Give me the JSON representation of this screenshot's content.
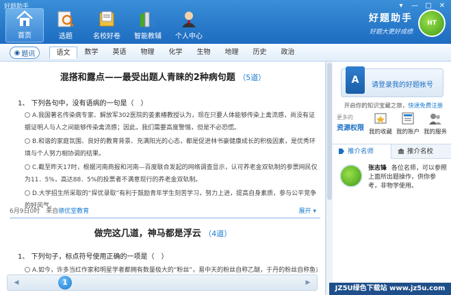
{
  "window": {
    "title": "好题助手",
    "controls": [
      "▾",
      "—",
      "□",
      "✕"
    ]
  },
  "nav": [
    {
      "label": "首页",
      "icon": "home-icon"
    },
    {
      "label": "选题",
      "icon": "search-select-icon"
    },
    {
      "label": "名校好卷",
      "icon": "document-folder-icon"
    },
    {
      "label": "智能教辅",
      "icon": "books-icon"
    },
    {
      "label": "个人中心",
      "icon": "user-icon"
    }
  ],
  "brand": {
    "name": "好题助手",
    "slogan": "好题大更好成绩",
    "logo_text": "HT"
  },
  "news_button": "题讯",
  "subjects": [
    "语文",
    "数学",
    "英语",
    "物理",
    "化学",
    "生物",
    "地理",
    "历史",
    "政治"
  ],
  "active_subject": "语文",
  "section1": {
    "title": "混搭和露点——最受出题人青睐的2种病句题",
    "count": "5道",
    "question": "1、 下列各句中，没有语病的一句是（　）",
    "options": [
      "A.我国著名传染病专家、解放军302医院的姜素椿教授认为，现在只要人体能够传染上禽流感，尚没有证据证明人与人之间能够传染禽流感；因此，我们需要高度警惕，但是不必恐慌。",
      "B.和谐的家庭氛围、良好的教育背景、充满阳光的心态，都是促进林书豪健康成长的积极因素，是优秀环境与个人努力相协调的结果。",
      "C.截至昨天17时，根据河南商报和河南—百度联合发起的网络调查显示，认可养老金双轨制的参票网民仅为11．5%，高达88．5%的投票者不满意现行的养老金双轨制。",
      "D.大学招生所采取的“探优录取”有利于鼓励青年学生刻苦学习，努力上进，提高自身素质，参与公平竞争的好风气。"
    ],
    "meta_date": "6月9日0时",
    "meta_from": "来自",
    "meta_source": "德优堂教育",
    "expand": "展开"
  },
  "section2": {
    "title": "做完这几道，神马都是浮云",
    "count": "4道",
    "question": "1、 下列句子，标点符号使用正确的一项是（　）",
    "option_a": "A.如今，许多当红作家和明星学者都拥有数量极大的“粉丝”，易中天的粉丝自称乙醚，于丹的粉丝自称鱼丸。今天的"
  },
  "pager": {
    "current_page": "1"
  },
  "side": {
    "login_link": "请登录我的好题帐号",
    "login_note_prefix": "开启你的知识宝藏之旅，",
    "login_note_register": "快速免费注册",
    "more_label": "更多的",
    "permission_label": "资源权限",
    "quick_items": [
      {
        "label": "我的收藏",
        "icon": "favorites-icon"
      },
      {
        "label": "我的账户",
        "icon": "account-icon"
      },
      {
        "label": "我的服务",
        "icon": "service-icon"
      }
    ],
    "tabs": [
      "推介名师",
      "推介名校"
    ],
    "teacher_name": "张志锋",
    "teacher_desc": "各位名师，可以参照上面所出题操作，供你参考，非物学使用。"
  },
  "watermark": "JZ5U绿色下载站 www.jz5u.com",
  "colors": {
    "accent": "#1a7bd1",
    "toolbar": "#2a7ccc",
    "brand_green": "#4aa81f"
  }
}
